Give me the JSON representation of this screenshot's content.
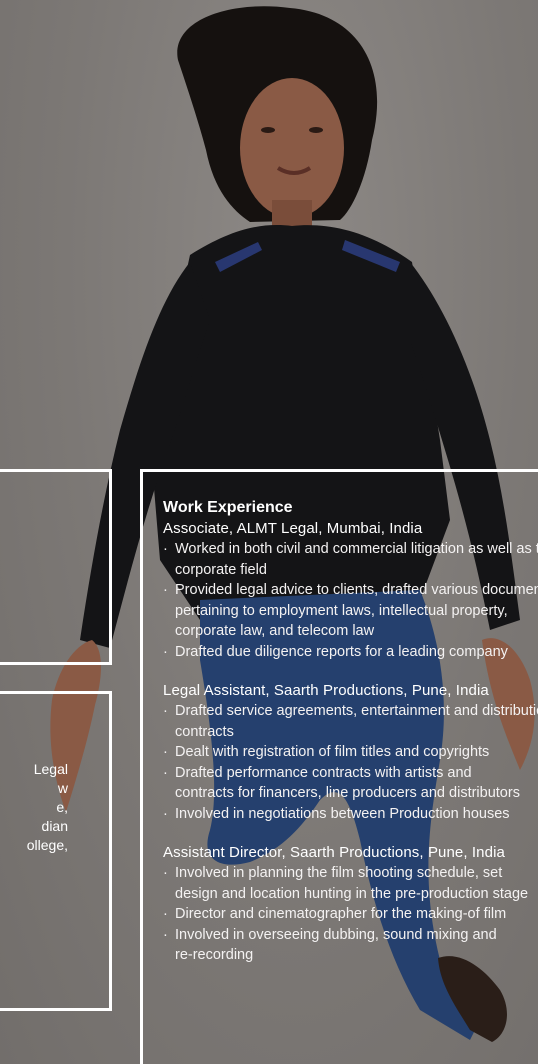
{
  "colors": {
    "background": "#7f7b78",
    "shirt": "#141416",
    "jeans": "#25406e",
    "skin": "#8a5a45",
    "hair": "#15110f",
    "frame": "#ffffff"
  },
  "left_panel": {
    "lines": [
      "Legal",
      "w",
      "e,",
      "",
      "dian",
      "ollege,"
    ]
  },
  "work_experience": {
    "heading": "Work Experience",
    "jobs": [
      {
        "title": "Associate, ALMT Legal, Mumbai, India",
        "bullets": [
          [
            "Worked in both civil and commercial litigation as well as the",
            "corporate field"
          ],
          [
            "Provided legal advice to clients, drafted various documents",
            "pertaining to employment laws, intellectual property,",
            "corporate law, and telecom law"
          ],
          [
            "Drafted due diligence reports for a leading company"
          ]
        ]
      },
      {
        "title": "Legal Assistant, Saarth Productions, Pune, India",
        "bullets": [
          [
            "Drafted service agreements, entertainment and distribution",
            "contracts"
          ],
          [
            "Dealt with registration of film titles and copyrights"
          ],
          [
            "Drafted performance contracts with artists and",
            "contracts for financers, line producers and distributors"
          ],
          [
            "Involved in negotiations between Production houses"
          ]
        ]
      },
      {
        "title": "Assistant Director, Saarth Productions, Pune, India",
        "bullets": [
          [
            "Involved in planning the film shooting schedule, set",
            "design and location hunting in the pre-production stage"
          ],
          [
            "Director and cinematographer for the making-of film"
          ],
          [
            "Involved in overseeing dubbing, sound mixing and",
            "re-recording"
          ]
        ]
      }
    ]
  }
}
